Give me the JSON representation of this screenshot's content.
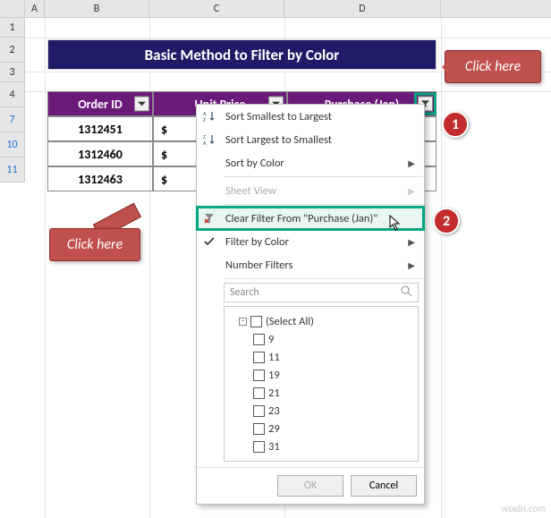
{
  "columns": {
    "a": "A",
    "b": "B",
    "c": "C",
    "d": "D"
  },
  "rows": {
    "r1": "1",
    "r2": "2",
    "r3": "3",
    "r4": "4",
    "r7": "7",
    "r10": "10",
    "r11": "11"
  },
  "title": "Basic Method to Filter by Color",
  "headers": {
    "order_id": "Order ID",
    "unit_price": "Unit Price",
    "purchase": "Purchase (Jan)"
  },
  "table_rows": [
    {
      "order_id": "1312451",
      "unit_price": "$"
    },
    {
      "order_id": "1312460",
      "unit_price": "$"
    },
    {
      "order_id": "1312463",
      "unit_price": "$"
    }
  ],
  "menu": {
    "sort_asc": "Sort Smallest to Largest",
    "sort_desc": "Sort Largest to Smallest",
    "sort_color": "Sort by Color",
    "sheet_view": "Sheet View",
    "clear_filter": "Clear Filter From \"Purchase (Jan)\"",
    "filter_color": "Filter by Color",
    "number_filters": "Number Filters",
    "search_placeholder": "Search",
    "select_all": "(Select All)",
    "items": [
      "9",
      "11",
      "19",
      "21",
      "23",
      "29",
      "31"
    ],
    "ok": "OK",
    "cancel": "Cancel"
  },
  "callouts": {
    "top": "Click here",
    "left": "Click here"
  },
  "badges": {
    "b1": "1",
    "b2": "2"
  },
  "watermark": "wsxdn.com"
}
